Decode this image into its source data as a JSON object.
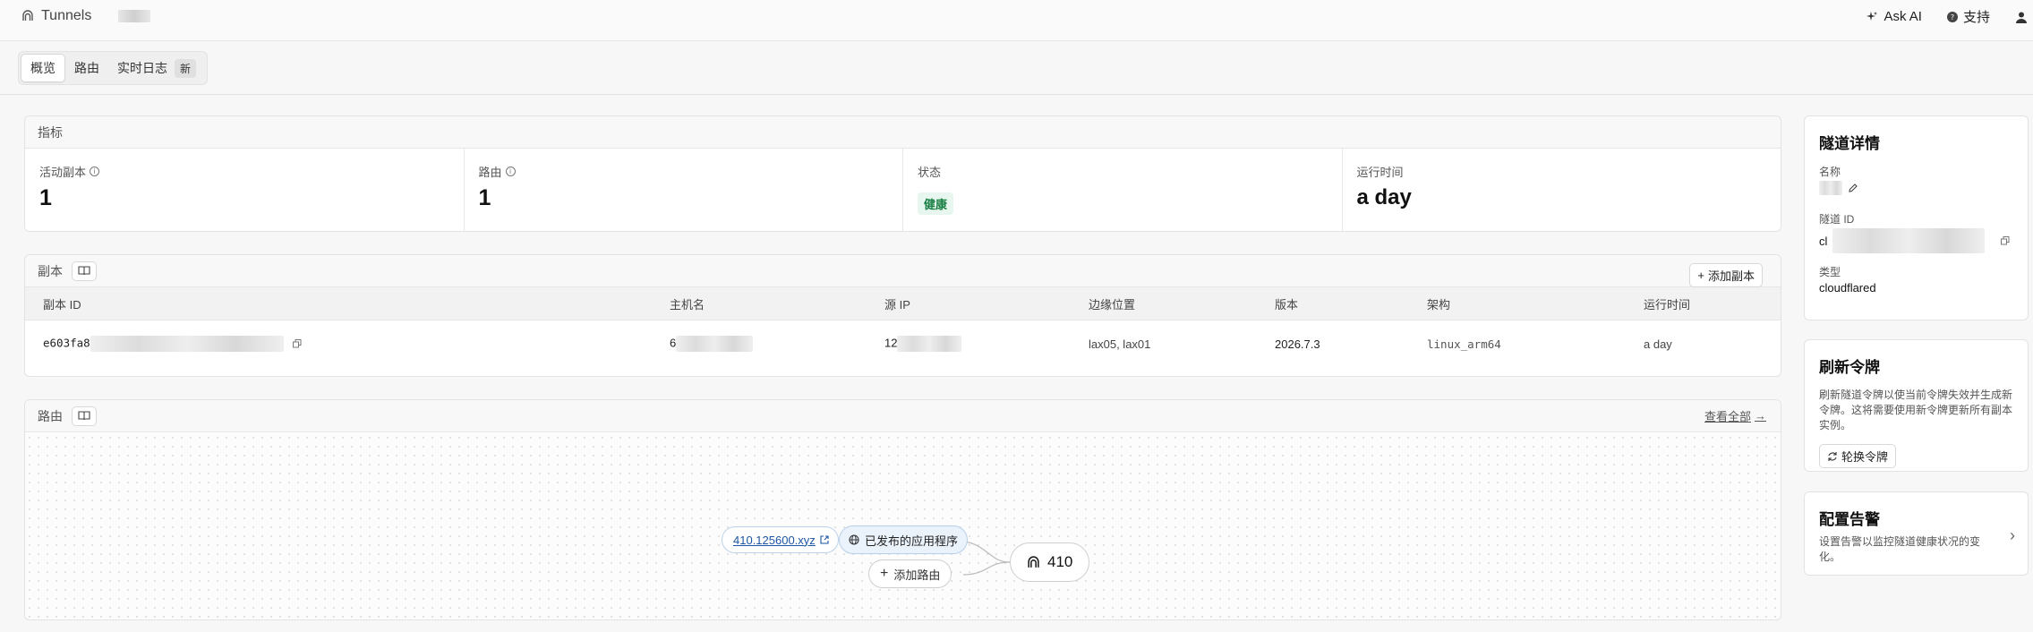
{
  "topbar": {
    "title": "Tunnels",
    "ask_ai": "Ask AI",
    "support": "支持"
  },
  "tabs": [
    {
      "label": "概览",
      "active": true
    },
    {
      "label": "路由",
      "active": false
    },
    {
      "label": "实时日志",
      "badge": "新",
      "active": false
    }
  ],
  "metrics": {
    "header": "指标",
    "items": [
      {
        "label": "活动副本",
        "value": "1"
      },
      {
        "label": "路由",
        "value": "1"
      },
      {
        "label": "状态",
        "status": "健康"
      },
      {
        "label": "运行时间",
        "value": "a day"
      }
    ]
  },
  "replicas": {
    "header": "副本",
    "add_button": "添加副本",
    "columns": [
      "副本 ID",
      "主机名",
      "源 IP",
      "边缘位置",
      "版本",
      "架构",
      "运行时间"
    ],
    "rows": [
      {
        "replica_id": "e603fa8",
        "hostname": "6",
        "source_ip": "12",
        "edge": "lax05, lax01",
        "version": "2026.7.3",
        "arch": "linux_arm64",
        "uptime": "a day"
      }
    ]
  },
  "routes": {
    "header": "路由",
    "view_all": "查看全部",
    "hostname_link": "410.125600.xyz",
    "app_label": "已发布的应用程序",
    "add_route": "添加路由",
    "tunnel_name": "410"
  },
  "details": {
    "title": "隧道详情",
    "name_label": "名称",
    "id_label": "隧道 ID",
    "id_prefix": "cl",
    "type_label": "类型",
    "type_value": "cloudflared"
  },
  "refresh": {
    "title": "刷新令牌",
    "desc": "刷新隧道令牌以使当前令牌失效并生成新令牌。这将需要使用新令牌更新所有副本实例。",
    "button": "轮换令牌"
  },
  "alerts": {
    "title": "配置告警",
    "desc": "设置告警以监控隧道健康状况的变化。"
  },
  "colors": {
    "healthy_bg": "#e7f6ee",
    "healthy_text": "#1a7f44",
    "link": "#1b55a3",
    "app_node_bg": "#eaf2fb"
  }
}
